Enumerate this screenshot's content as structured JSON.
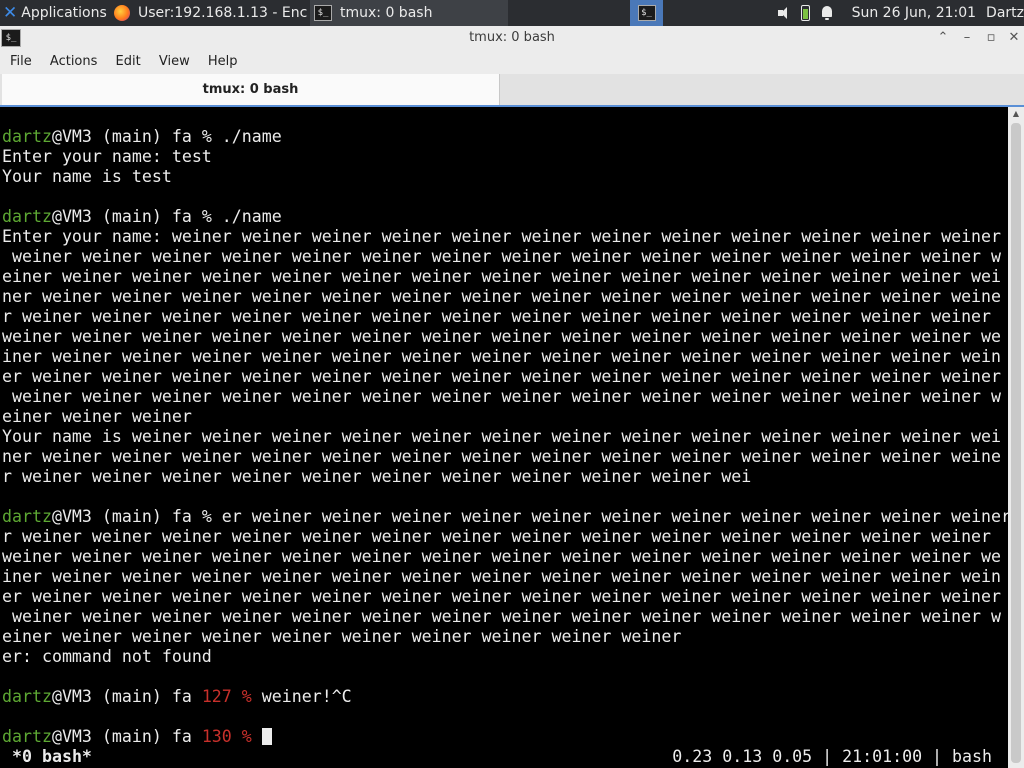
{
  "taskbar": {
    "apps_label": "Applications",
    "tasks": [
      {
        "label": "User:192.168.1.13 - Enc...",
        "icon": "firefox-icon"
      },
      {
        "label": "tmux: 0 bash",
        "icon": "terminal-icon"
      }
    ],
    "clock": "Sun 26 Jun, 21:01",
    "user": "Dartz"
  },
  "window": {
    "title": "tmux: 0 bash",
    "menu": [
      "File",
      "Actions",
      "Edit",
      "View",
      "Help"
    ],
    "tab_label": "tmux: 0 bash"
  },
  "terminal": {
    "prompt_user": "dartz",
    "prompt_host": "@VM3 (main) fa ",
    "lines": [
      "",
      "Enter your name: test",
      "Your name is test",
      "",
      "",
      "Enter your name: weiner weiner weiner weiner weiner weiner weiner weiner weiner weiner weiner weiner",
      " weiner weiner weiner weiner weiner weiner weiner weiner weiner weiner weiner weiner weiner weiner w",
      "einer weiner weiner weiner weiner weiner weiner weiner weiner weiner weiner weiner weiner weiner wei",
      "ner weiner weiner weiner weiner weiner weiner weiner weiner weiner weiner weiner weiner weiner weine",
      "r weiner weiner weiner weiner weiner weiner weiner weiner weiner weiner weiner weiner weiner weiner",
      "weiner weiner weiner weiner weiner weiner weiner weiner weiner weiner weiner weiner weiner weiner we",
      "iner weiner weiner weiner weiner weiner weiner weiner weiner weiner weiner weiner weiner weiner wein",
      "er weiner weiner weiner weiner weiner weiner weiner weiner weiner weiner weiner weiner weiner weiner",
      " weiner weiner weiner weiner weiner weiner weiner weiner weiner weiner weiner weiner weiner weiner w",
      "einer weiner weiner",
      "Your name is weiner weiner weiner weiner weiner weiner weiner weiner weiner weiner weiner weiner wei",
      "ner weiner weiner weiner weiner weiner weiner weiner weiner weiner weiner weiner weiner weiner weine",
      "r weiner weiner weiner weiner weiner weiner weiner weiner weiner weiner wei",
      "",
      "",
      "r weiner weiner weiner weiner weiner weiner weiner weiner weiner weiner weiner weiner weiner weiner",
      "weiner weiner weiner weiner weiner weiner weiner weiner weiner weiner weiner weiner weiner weiner we",
      "iner weiner weiner weiner weiner weiner weiner weiner weiner weiner weiner weiner weiner weiner wein",
      "er weiner weiner weiner weiner weiner weiner weiner weiner weiner weiner weiner weiner weiner weiner",
      " weiner weiner weiner weiner weiner weiner weiner weiner weiner weiner weiner weiner weiner weiner w",
      "einer weiner weiner weiner weiner weiner weiner weiner weiner weiner",
      "er: command not found",
      "",
      "",
      "",
      ""
    ],
    "prompt_cmds": {
      "p1": "% ./name",
      "p2": "% ./name",
      "p3": "% er weiner weiner weiner weiner weiner weiner weiner weiner weiner weiner weiner weiner weine",
      "p4_code": "127 %",
      "p4_cmd": " weiner!^C",
      "p5_code": "130 %"
    },
    "status_left": "*0 bash*",
    "status_right": "0.23 0.13 0.05 | 21:01:00 | bash"
  },
  "colors": {
    "prompt_user": "#5da833",
    "exit_code": "#c8302b",
    "panel_bg": "#2b2d31",
    "accent": "#5a8fd6"
  }
}
